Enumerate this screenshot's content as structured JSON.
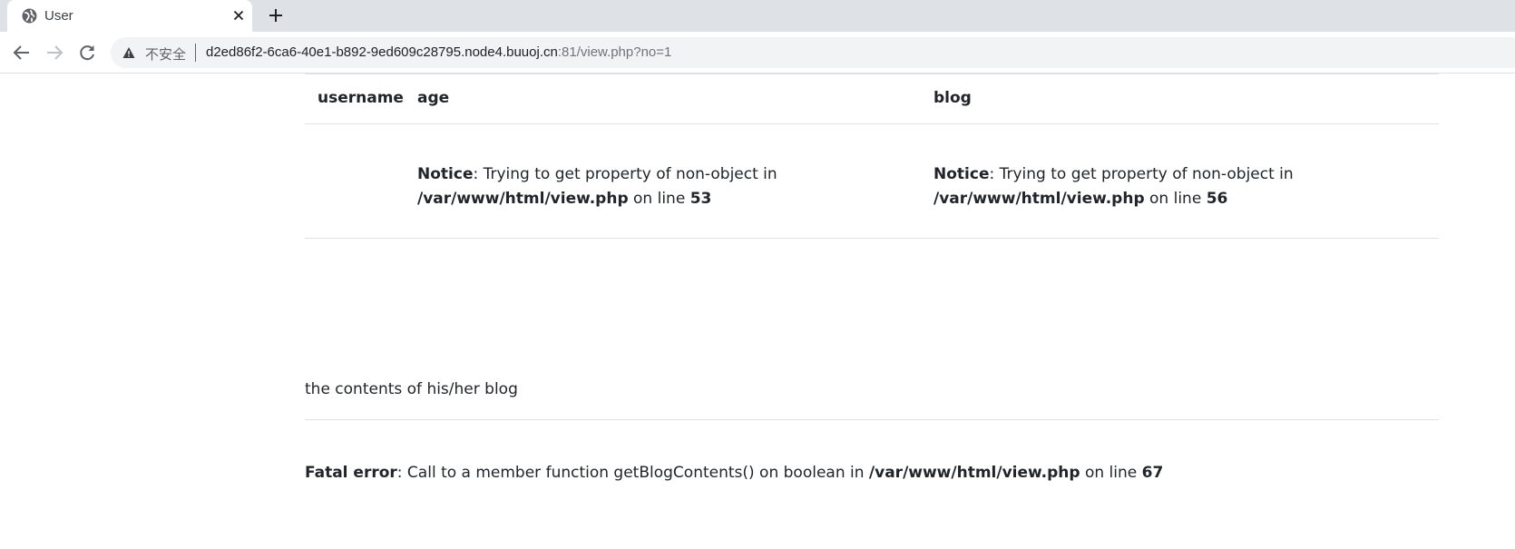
{
  "browser": {
    "tab": {
      "title": "User",
      "favicon": "globe-icon",
      "close": "close-icon"
    },
    "new_tab": "plus-icon",
    "nav": {
      "back": "arrow-left-icon",
      "forward": "arrow-right-icon",
      "reload": "reload-icon"
    },
    "address": {
      "security_label": "不安全",
      "security_icon": "warning-triangle-icon",
      "host": "d2ed86f2-6ca6-40e1-b892-9ed609c28795.node4.buuoj.cn",
      "path": ":81/view.php?no=1"
    }
  },
  "page": {
    "table": {
      "headers": [
        "username",
        "age",
        "blog"
      ],
      "age_notice": {
        "label": "Notice",
        "message": ": Trying to get property of non-object in ",
        "file": "/var/www/html/view.php",
        "on_line": " on line ",
        "line": "53"
      },
      "blog_notice": {
        "label": "Notice",
        "message": ": Trying to get property of non-object in ",
        "file": "/var/www/html/view.php",
        "on_line": " on line ",
        "line": "56"
      }
    },
    "blog_section": {
      "heading": "the contents of his/her blog"
    },
    "fatal_error": {
      "label": "Fatal error",
      "message": ": Call to a member function getBlogContents() on boolean in ",
      "file": "/var/www/html/view.php",
      "on_line": " on line ",
      "line": "67"
    }
  }
}
